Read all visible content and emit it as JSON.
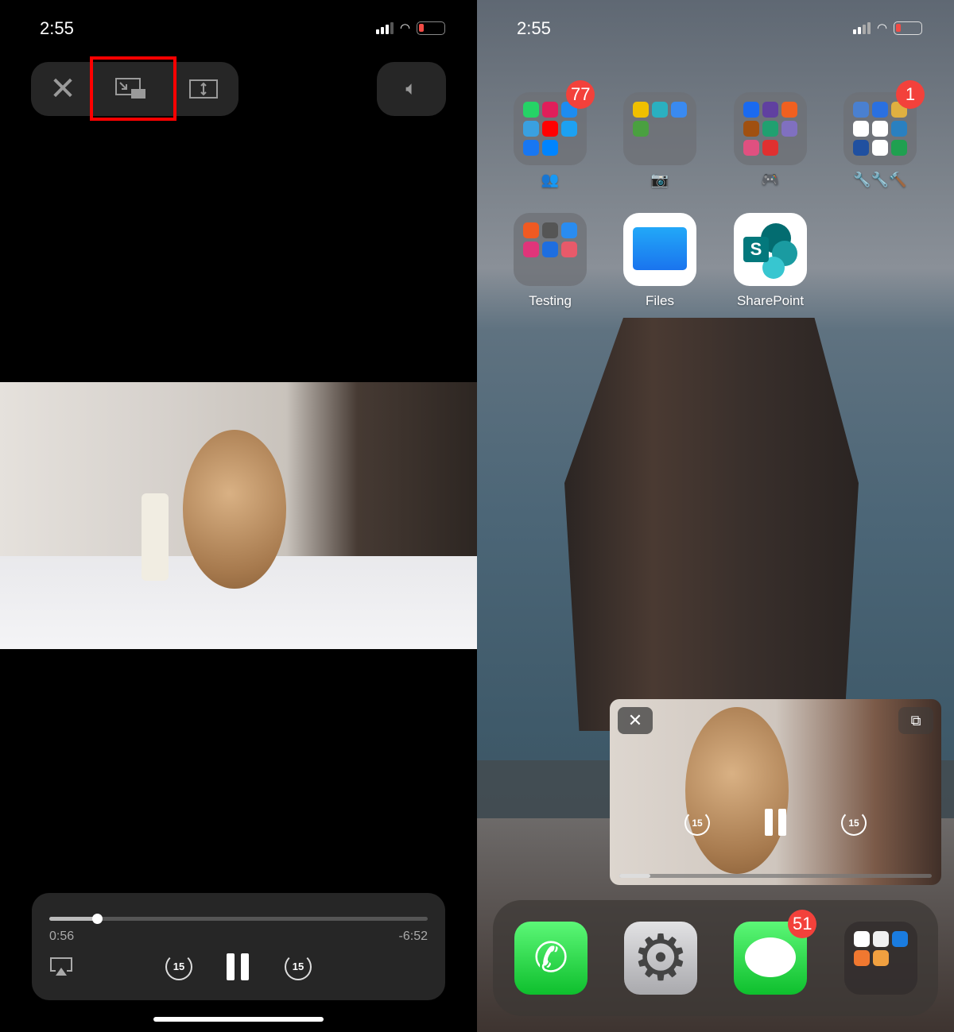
{
  "left": {
    "status": {
      "time": "2:55"
    },
    "top_controls": {
      "close_icon": "close-icon",
      "pip_icon": "picture-in-picture-icon",
      "aspect_icon": "resize-vertical-icon",
      "volume_icon": "speaker-icon",
      "highlight_color": "#ff0000"
    },
    "playback": {
      "elapsed": "0:56",
      "remaining": "-6:52",
      "progress": 0.125,
      "skip_back": "15",
      "skip_forward": "15",
      "airplay_icon": "airplay-icon",
      "pause_icon": "pause-icon"
    }
  },
  "right": {
    "status": {
      "time": "2:55"
    },
    "folders": [
      {
        "label": "👥",
        "badge": "77"
      },
      {
        "label": "📷",
        "badge": ""
      },
      {
        "label": "🎮",
        "badge": ""
      },
      {
        "label": "🔧🔧🔨",
        "badge": "1"
      }
    ],
    "apps": [
      {
        "label": "Testing",
        "type": "folder"
      },
      {
        "label": "Files",
        "type": "app"
      },
      {
        "label": "SharePoint",
        "type": "app"
      }
    ],
    "pip": {
      "skip_back": "15",
      "skip_forward": "15",
      "progress": 0.1
    },
    "dock": [
      {
        "name": "Phone",
        "badge": ""
      },
      {
        "name": "Settings",
        "badge": ""
      },
      {
        "name": "Messages",
        "badge": "51"
      },
      {
        "name": "Health folder",
        "badge": ""
      }
    ]
  }
}
